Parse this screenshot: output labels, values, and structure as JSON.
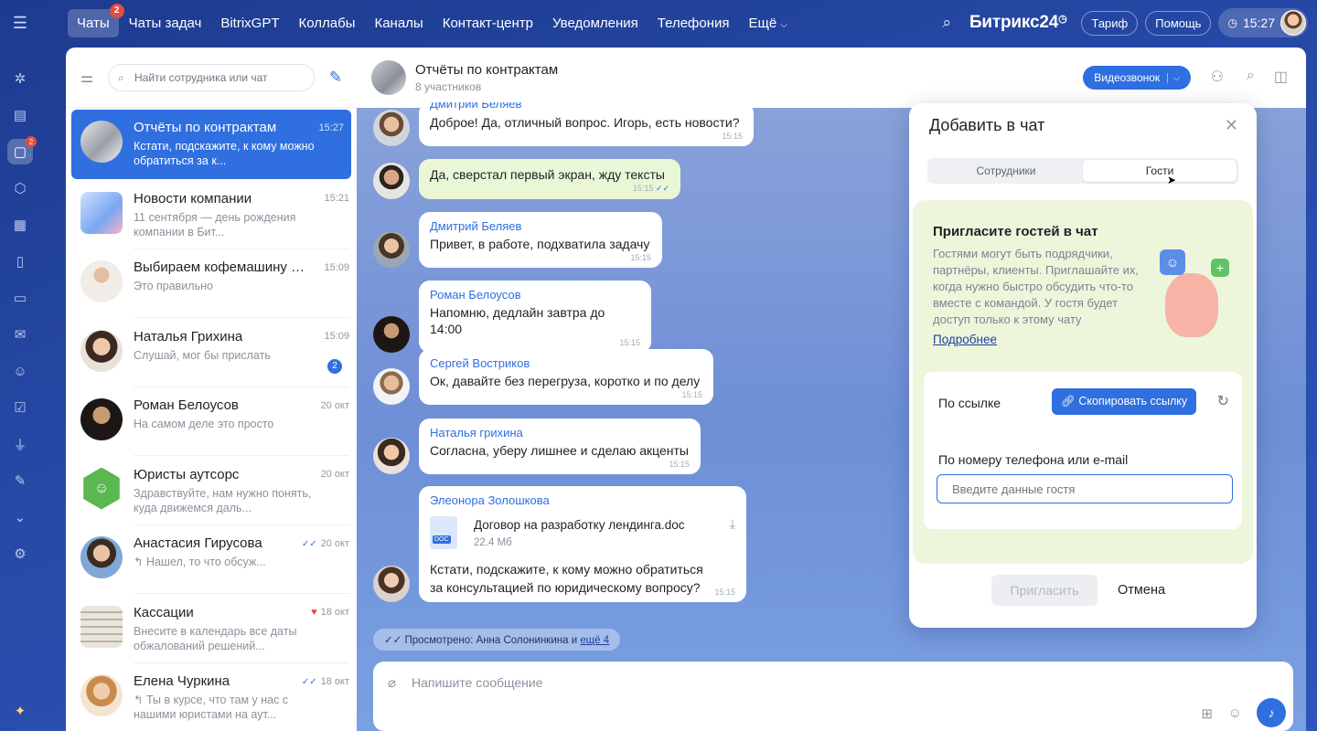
{
  "topbar": {
    "nav": [
      {
        "label": "Чаты",
        "badge": "2"
      },
      {
        "label": "Чаты задач"
      },
      {
        "label": "BitrixGPT"
      },
      {
        "label": "Коллабы"
      },
      {
        "label": "Каналы"
      },
      {
        "label": "Контакт-центр"
      },
      {
        "label": "Уведомления"
      },
      {
        "label": "Телефония"
      },
      {
        "label": "Ещё"
      }
    ],
    "brand": "Битрикс24",
    "tariff": "Тариф",
    "help": "Помощь",
    "time": "15:27"
  },
  "rail": {
    "chat_badge": "2"
  },
  "chatlist": {
    "search_placeholder": "Найти сотрудника или чат",
    "items": [
      {
        "name": "Отчёты по контрактам",
        "time": "15:27",
        "preview": "Кстати, подскажите, к кому можно обратиться за к..."
      },
      {
        "name": "Новости компании",
        "time": "15:21",
        "preview": "11 сентября — день рождения компании в Бит..."
      },
      {
        "name": "Выбираем кофемашину д...",
        "time": "15:09",
        "preview": "Это правильно"
      },
      {
        "name": "Наталья Грихина",
        "time": "15:09",
        "preview": "Слушай, мог бы прислать",
        "unread": "2"
      },
      {
        "name": "Роман Белоусов",
        "time": "20 окт",
        "preview": "На самом деле это просто"
      },
      {
        "name": "Юристы аутсорс",
        "time": "20 окт",
        "preview": "Здравствуйте, нам нужно понять, куда движемся даль..."
      },
      {
        "name": "Анастасия Гирусова",
        "time": "20 окт",
        "preview": "Нашел, то что обсуж..."
      },
      {
        "name": "Кассации",
        "time": "18 окт",
        "preview": "Внесите в календарь все даты обжалований решений..."
      },
      {
        "name": "Елена Чуркина",
        "time": "18 окт",
        "preview": "Ты в курсе, что там у нас с нашими юристами на аут..."
      }
    ]
  },
  "chat": {
    "title": "Отчёты по контрактам",
    "subtitle": "8 участников",
    "video_label": "Видеозвонок",
    "messages": [
      {
        "sender": "Дмитрий Беляев",
        "text": "Доброе! Да, отличный вопрос. Игорь, есть новости?",
        "time": "15:15"
      },
      {
        "sender": "",
        "text": "Да, сверстал первый экран, жду тексты",
        "time": "15:15"
      },
      {
        "sender": "Дмитрий Беляев",
        "text": "Привет, в работе, подхватила задачу",
        "time": "15:15"
      },
      {
        "sender": "Роман Белоусов",
        "text": "Напомню, дедлайн завтра до 14:00",
        "time": "15:15"
      },
      {
        "sender": "Сергей Востриков",
        "text": "Ок, давайте без перегруза, коротко и по делу",
        "time": "15:15"
      },
      {
        "sender": "Наталья грихина",
        "text": "Согласна, уберу лишнее и сделаю акценты",
        "time": "15:15"
      },
      {
        "sender": "Элеонора Золошкова",
        "file_name": "Договор на разработку лендинга.doc",
        "file_size": "22.4 Мб",
        "file_type": "DOC",
        "text": "Кстати, подскажите, к кому можно обратиться за консультацией по юридическому вопросу?",
        "time": "15:15"
      }
    ],
    "seen_text": "Просмотрено: Анна Солонинкина и",
    "seen_more": "ещё 4",
    "composer_placeholder": "Напишите сообщение"
  },
  "popup": {
    "title": "Добавить в чат",
    "tabs": [
      "Сотрудники",
      "Гости"
    ],
    "active_tab": "Гости",
    "heading": "Пригласите гостей в чат",
    "description": "Гостями могут быть подрядчики, партнёры, клиенты. Приглашайте их, когда нужно быстро обсудить что-то вместе с командой. У гостя будет доступ только к этому чату",
    "more_link": "Подробнее",
    "by_link_label": "По ссылке",
    "copy_link_label": "Скопировать ссылку",
    "by_contact_label": "По номеру телефона или e-mail",
    "guest_placeholder": "Введите данные гостя",
    "invite_label": "Пригласить",
    "cancel_label": "Отмена"
  },
  "colors": {
    "accent": "#2f6fe0",
    "badge": "#e44d3a",
    "green_bubble": "#eaf7d6",
    "invite_panel": "#edf6db"
  }
}
